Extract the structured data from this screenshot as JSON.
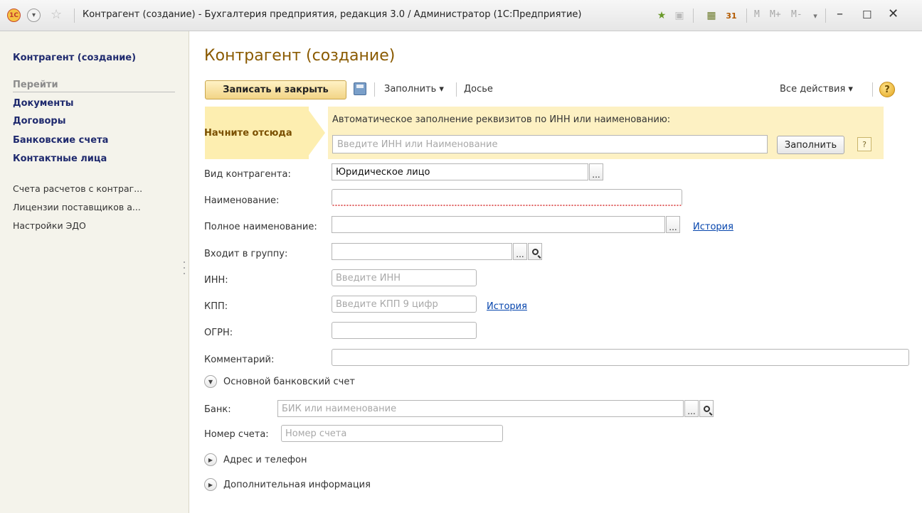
{
  "window": {
    "title": "Контрагент (создание) - Бухгалтерия предприятия, редакция 3.0 / Администратор  (1С:Предприятие)",
    "logo_text": "1С",
    "memory_buttons": [
      "M",
      "M+",
      "M-"
    ],
    "icons": [
      "star-icon",
      "calculator-icon",
      "calendar-icon",
      "minimize-icon",
      "maximize-icon",
      "close-icon"
    ]
  },
  "sidebar": {
    "title": "Контрагент (создание)",
    "nav_header": "Перейти",
    "nav_items": [
      "Документы",
      "Договоры",
      "Банковские счета",
      "Контактные лица"
    ],
    "links": [
      "Счета расчетов с контраг...",
      "Лицензии поставщиков а...",
      "Настройки ЭДО"
    ]
  },
  "form": {
    "title": "Контрагент (создание)",
    "toolbar": {
      "save_close": "Записать и закрыть",
      "fill": "Заполнить ▾",
      "dossier": "Досье",
      "all_actions": "Все действия ▾",
      "help": "?"
    },
    "autofill": {
      "start_label": "Начните отсюда",
      "caption": "Автоматическое заполнение реквизитов по ИНН или наименованию:",
      "placeholder": "Введите ИНН или Наименование",
      "fill_button": "Заполнить",
      "hint": "?"
    },
    "fields": {
      "kind_label": "Вид контрагента:",
      "kind_value": "Юридическое лицо",
      "name_label": "Наименование:",
      "name_value": "",
      "full_name_label": "Полное наименование:",
      "full_name_value": "",
      "history_link": "История",
      "group_label": "Входит в группу:",
      "group_value": "",
      "inn_label": "ИНН:",
      "inn_placeholder": "Введите ИНН",
      "kpp_label": "КПП:",
      "kpp_placeholder": "Введите КПП 9 цифр",
      "ogrn_label": "ОГРН:",
      "ogrn_value": "",
      "comment_label": "Комментарий:",
      "comment_value": ""
    },
    "bank_section": {
      "title": "Основной банковский счет",
      "bank_label": "Банк:",
      "bank_placeholder": "БИК или наименование",
      "account_label": "Номер счета:",
      "account_placeholder": "Номер счета"
    },
    "collapsed_sections": [
      "Адрес и телефон",
      "Дополнительная информация"
    ]
  }
}
